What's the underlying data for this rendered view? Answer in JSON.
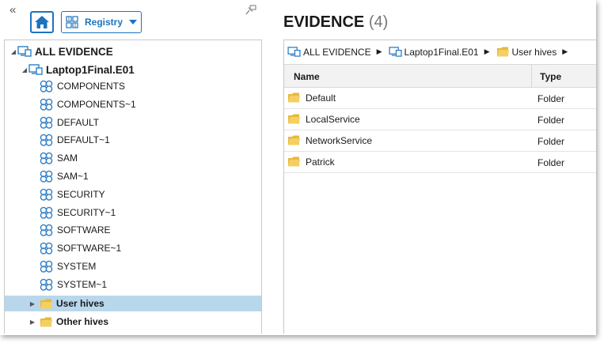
{
  "toolbar": {
    "collapse_glyph": "«",
    "home_icon": "home-icon",
    "registry_label": "Registry",
    "registry_icon": "registry-grid-icon",
    "pin_icon": "pin-icon"
  },
  "tree": {
    "root_label": "ALL EVIDENCE",
    "evidence_label": "Laptop1Final.E01",
    "hives": [
      "COMPONENTS",
      "COMPONENTS~1",
      "DEFAULT",
      "DEFAULT~1",
      "SAM",
      "SAM~1",
      "SECURITY",
      "SECURITY~1",
      "SOFTWARE",
      "SOFTWARE~1",
      "SYSTEM",
      "SYSTEM~1"
    ],
    "folders": [
      "User hives",
      "Other hives"
    ],
    "selected": "User hives"
  },
  "header": {
    "title": "EVIDENCE",
    "count": "(4)"
  },
  "breadcrumb": [
    "ALL EVIDENCE",
    "Laptop1Final.E01",
    "User hives"
  ],
  "table": {
    "columns": [
      "Name",
      "Type"
    ],
    "rows": [
      {
        "name": "Default",
        "type": "Folder"
      },
      {
        "name": "LocalService",
        "type": "Folder"
      },
      {
        "name": "NetworkService",
        "type": "Folder"
      },
      {
        "name": "Patrick",
        "type": "Folder"
      }
    ]
  },
  "colors": {
    "accent": "#1e73be",
    "selection": "#b9d7ec",
    "hive_icon": "#2e7fc8",
    "folder": "#e9b83a"
  }
}
